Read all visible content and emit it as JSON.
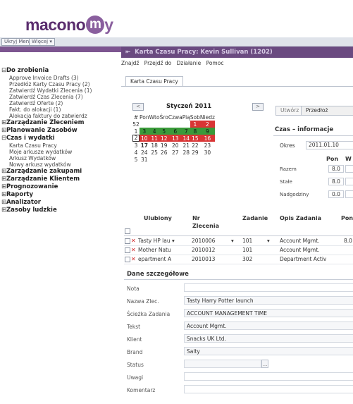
{
  "app": {
    "logo_prefix": "macono",
    "logo_circle": "m",
    "logo_suffix": "y"
  },
  "toolbar": {
    "hide_menu": "Ukryj Menu",
    "more": "Więcej ▾"
  },
  "window": {
    "title": "Karta Czasu Pracy: Kevin Sullivan (1202)"
  },
  "menubar": [
    "Znajdź",
    "Przejdź do",
    "Działanie",
    "Pomoc"
  ],
  "tab": "Karta Czasu Pracy",
  "nav": {
    "todo": {
      "title": "Do zrobienia",
      "items": [
        "Approve Invoice Drafts (3)",
        "Przedłóż Karty Czasu Pracy (2)",
        "Zatwierdź Wydatki Zlecenia (1)",
        "Zatwierdź Czas Zlecenia (7)",
        "Zatwierdź Oferte (2)",
        "Fakt. do alokacji (1)",
        "Alokacja faktury do zatwierdz"
      ]
    },
    "sections_a": [
      "Zarządzanie Zleceniem",
      "Planowanie Zasobów"
    ],
    "time": {
      "title": "Czas i wydatki",
      "items": [
        "Karta Czasu Pracy",
        "Moje arkusze wydatków",
        "Arkusz Wydatków",
        "Nowy arkusz wydatków"
      ]
    },
    "sections_b": [
      "Zarządzanie zakupami",
      "Zarządzanie Klientem",
      "Prognozowanie",
      "Raporty",
      "Analizator",
      "Zasoby ludzkie"
    ]
  },
  "calendar": {
    "title": "Styczeń 2011",
    "prev": "<",
    "next": ">",
    "days": [
      "Pon",
      "Wto",
      "Śro",
      "Czwa",
      "Pią",
      "Sob",
      "Niedz"
    ],
    "weeks": [
      {
        "wk": "52",
        "d": [
          "",
          "",
          "",
          "",
          "",
          "1",
          "2"
        ]
      },
      {
        "wk": "1",
        "d": [
          "3",
          "4",
          "5",
          "6",
          "7",
          "8",
          "9"
        ]
      },
      {
        "wk": "2",
        "d": [
          "10",
          "11",
          "12",
          "13",
          "14",
          "15",
          "16"
        ]
      },
      {
        "wk": "3",
        "d": [
          "17",
          "18",
          "19",
          "20",
          "21",
          "22",
          "23"
        ]
      },
      {
        "wk": "4",
        "d": [
          "24",
          "25",
          "26",
          "27",
          "28",
          "29",
          "30"
        ]
      },
      {
        "wk": "5",
        "d": [
          "31",
          "",
          "",
          "",
          "",
          "",
          ""
        ]
      }
    ]
  },
  "panel": {
    "create": "Utwórz",
    "submit": "Przedłoż",
    "info_title": "Czas – informacje",
    "period_label": "Okres",
    "period_value": "2011.01.10",
    "col_mon": "Pon",
    "col_w": "W",
    "rows": [
      {
        "label": "Razem",
        "value": "8.0"
      },
      {
        "label": "Stałe",
        "value": "8.0"
      },
      {
        "label": "Nadgodziny",
        "value": "0.0"
      }
    ]
  },
  "grid": {
    "headers": [
      "Ulubiony",
      "Nr Zlecenia",
      "Zadanie",
      "Opis Zadania",
      "Pon"
    ],
    "rows": [
      {
        "fav": "Tasty HP lau ▾",
        "job": "2010006",
        "task": "101",
        "desc": "Account Mgmt.",
        "mon": "8.0"
      },
      {
        "fav": "Mother Natu",
        "job": "2010012",
        "task": "101",
        "desc": "Account Mgmt.",
        "mon": ""
      },
      {
        "fav": "epartment A",
        "job": "2010013",
        "task": "302",
        "desc": "Department Activ",
        "mon": ""
      }
    ]
  },
  "details": {
    "title": "Dane szczegółowe",
    "fields": [
      {
        "label": "Nota",
        "value": ""
      },
      {
        "label": "Nazwa Zlec.",
        "value": "Tasty Harry Potter launch"
      },
      {
        "label": "Ścieżka Zadania",
        "value": "ACCOUNT MANAGEMENT TIME"
      },
      {
        "label": "Tekst",
        "value": "Account Mgmt."
      },
      {
        "label": "Klient",
        "value": "Snacks UK Ltd."
      },
      {
        "label": "Brand",
        "value": "Salty"
      },
      {
        "label": "Status",
        "value": ""
      },
      {
        "label": "Uwagi",
        "value": ""
      },
      {
        "label": "Komentarz",
        "value": ""
      }
    ]
  },
  "colors": {
    "brand": "#5a2d6e",
    "brand_light": "#8a5f9e",
    "band": "#7d5590",
    "green": "#3a9a3a",
    "red": "#d93535"
  }
}
